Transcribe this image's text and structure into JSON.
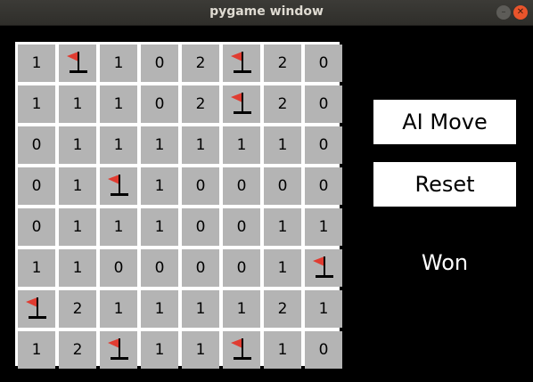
{
  "window": {
    "title": "pygame window"
  },
  "board": {
    "rows": 8,
    "cols": 8,
    "cells": [
      [
        "1",
        "F",
        "1",
        "0",
        "2",
        "F",
        "2",
        "0"
      ],
      [
        "1",
        "1",
        "1",
        "0",
        "2",
        "F",
        "2",
        "0"
      ],
      [
        "0",
        "1",
        "1",
        "1",
        "1",
        "1",
        "1",
        "0"
      ],
      [
        "0",
        "1",
        "F",
        "1",
        "0",
        "0",
        "0",
        "0"
      ],
      [
        "0",
        "1",
        "1",
        "1",
        "0",
        "0",
        "1",
        "1"
      ],
      [
        "1",
        "1",
        "0",
        "0",
        "0",
        "0",
        "1",
        "F"
      ],
      [
        "F",
        "2",
        "1",
        "1",
        "1",
        "1",
        "2",
        "1"
      ],
      [
        "1",
        "2",
        "F",
        "1",
        "1",
        "F",
        "1",
        "0"
      ]
    ],
    "flag_icon": "flag-icon",
    "colors": {
      "cell": "#b4b4b4",
      "grid_line": "#ffffff",
      "flag": "#e03c31",
      "flag_pole": "#000000"
    }
  },
  "controls": {
    "ai_move_label": "AI Move",
    "reset_label": "Reset"
  },
  "status": {
    "text": "Won"
  }
}
